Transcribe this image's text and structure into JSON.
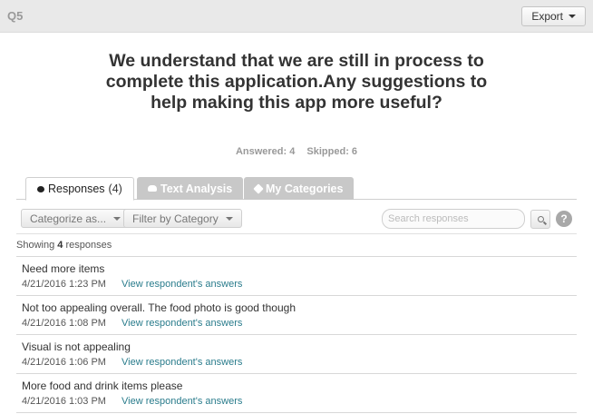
{
  "header": {
    "question_number": "Q5",
    "export_label": "Export"
  },
  "question": {
    "title": "We understand that we are still in process to complete this application.Any suggestions to help making this app more useful?",
    "answered": "Answered: 4",
    "skipped": "Skipped: 6"
  },
  "tabs": [
    {
      "label": "Responses",
      "count": "(4)",
      "icon": "speech-bubble-icon"
    },
    {
      "label": "Text Analysis",
      "icon": "cloud-icon"
    },
    {
      "label": "My Categories",
      "icon": "tag-icon"
    }
  ],
  "toolbar": {
    "categorize_label": "Categorize as...",
    "filter_label": "Filter by Category",
    "search_placeholder": "Search responses",
    "help_label": "?"
  },
  "showing": {
    "prefix": "Showing",
    "count": "4",
    "suffix": "responses"
  },
  "responses": [
    {
      "text": "Need more items",
      "date": "4/21/2016 1:23 PM",
      "link": "View respondent's answers"
    },
    {
      "text": "Not too appealing overall. The food photo is good though",
      "date": "4/21/2016 1:08 PM",
      "link": "View respondent's answers"
    },
    {
      "text": "Visual is not appealing",
      "date": "4/21/2016 1:06 PM",
      "link": "View respondent's answers"
    },
    {
      "text": "More food and drink items please",
      "date": "4/21/2016 1:03 PM",
      "link": "View respondent's answers"
    }
  ],
  "colors": {
    "link": "#2a7c8c",
    "inactive_tab": "#c8c8c8",
    "topbar": "#e9e9e9"
  }
}
